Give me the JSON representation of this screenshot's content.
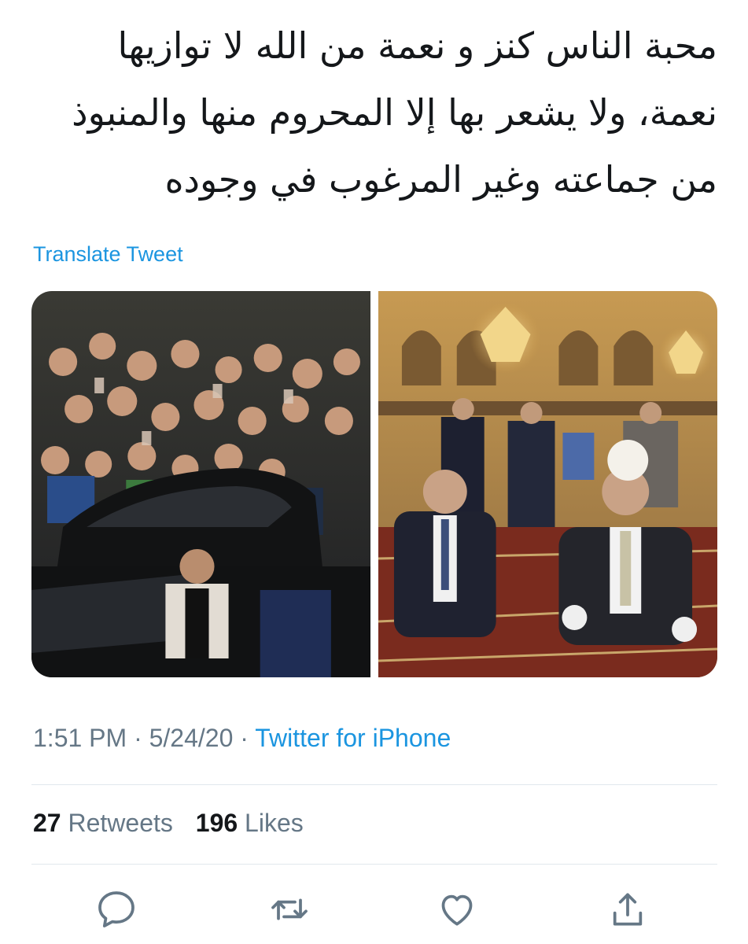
{
  "tweet": {
    "text_lines": [
      "محبة الناس كنز و نعمة من الله لا توازيها",
      "نعمة، ولا يشعر بها إلا المحروم منها والمنبوذ",
      "من جماعته وغير المرغوب في وجوده"
    ],
    "translate_label": "Translate Tweet"
  },
  "media": {
    "photos": [
      {
        "icon": "crowd-photo"
      },
      {
        "icon": "mosque-photo"
      }
    ]
  },
  "meta": {
    "time": "1:51 PM",
    "separator": "·",
    "date": "5/24/20",
    "source": "Twitter for iPhone"
  },
  "stats": {
    "retweets_count": "27",
    "retweets_label": "Retweets",
    "likes_count": "196",
    "likes_label": "Likes"
  },
  "actions": {
    "icons": [
      "reply-icon",
      "retweet-icon",
      "like-icon",
      "share-icon"
    ]
  },
  "colors": {
    "accent": "#1b95e0",
    "muted": "#657786",
    "text": "#14171a",
    "divider": "#e1e8ed"
  }
}
